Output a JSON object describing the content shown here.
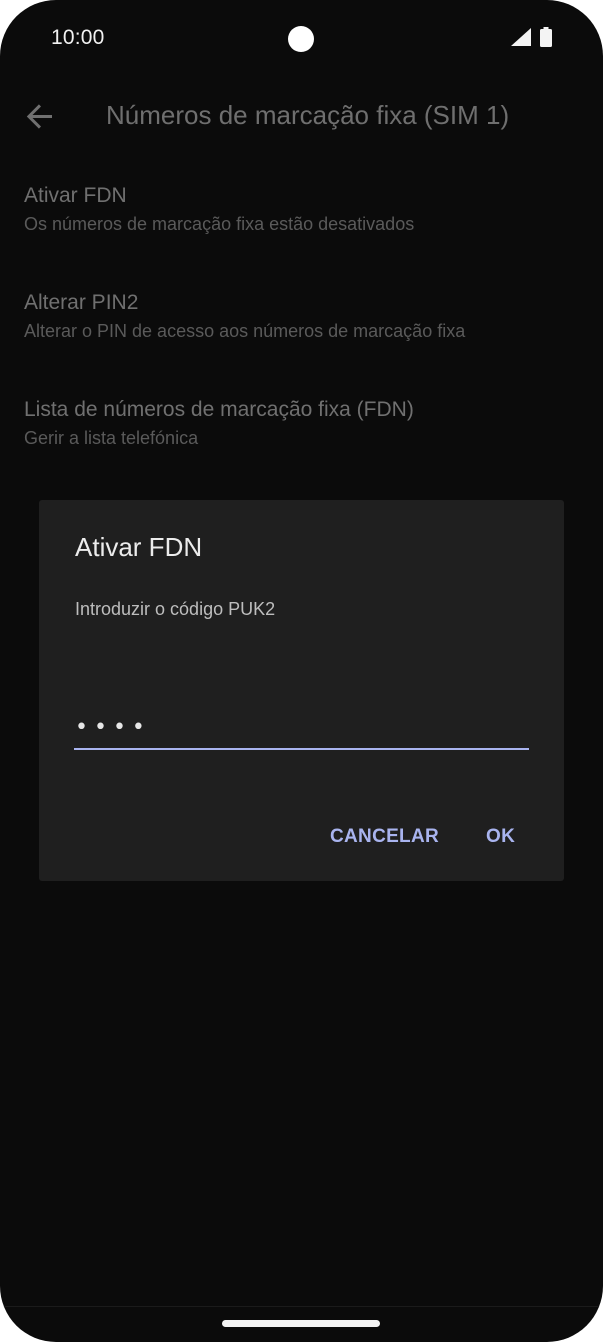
{
  "status_bar": {
    "time": "10:00"
  },
  "screen": {
    "title": "Números de marcação fixa (SIM 1)",
    "back_icon": "arrow-back-icon"
  },
  "preferences": [
    {
      "title": "Ativar FDN",
      "summary": "Os números de marcação fixa estão desativados"
    },
    {
      "title": "Alterar PIN2",
      "summary": "Alterar o PIN de acesso aos números de marcação fixa"
    },
    {
      "title": "Lista de números de marcação fixa (FDN)",
      "summary": "Gerir a lista telefónica"
    }
  ],
  "dialog": {
    "title": "Ativar FDN",
    "message": "Introduzir o código PUK2",
    "field_value": "••••",
    "cancel_label": "CANCELAR",
    "ok_label": "OK"
  },
  "colors": {
    "background": "#0b0b0b",
    "dialog_background": "#1f1f1f",
    "accent": "#a9b4ef"
  }
}
